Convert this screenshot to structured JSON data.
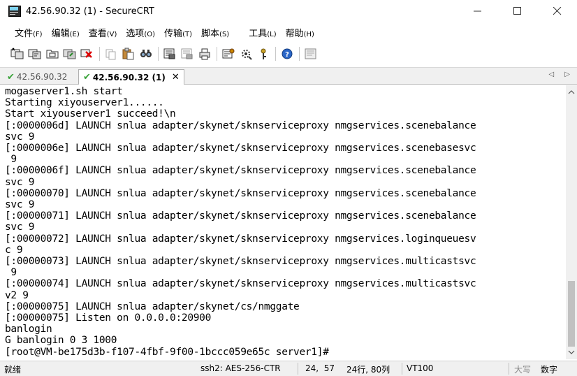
{
  "window": {
    "title": "42.56.90.32 (1) - SecureCRT",
    "icon": "securecrt-app-icon",
    "controls": [
      "minimize-icon",
      "maximize-icon",
      "close-icon"
    ]
  },
  "menu": {
    "file": {
      "label": "文件",
      "accel": "(F)"
    },
    "edit": {
      "label": "编辑",
      "accel": "(E)"
    },
    "view": {
      "label": "查看",
      "accel": "(V)"
    },
    "options": {
      "label": "选项",
      "accel": "(O)"
    },
    "transfer": {
      "label": "传输",
      "accel": "(T)"
    },
    "script": {
      "label": "脚本",
      "accel": "(S)"
    },
    "tools": {
      "label": "工具",
      "accel": "(L)"
    },
    "help": {
      "label": "帮助",
      "accel": "(H)"
    }
  },
  "toolbar": {
    "icons": [
      "connect-icon",
      "quick-connect-icon",
      "connect-in-tab-icon",
      "reconnect-icon",
      "disconnect-icon",
      "copy-icon",
      "paste-icon",
      "find-icon",
      "print-icon",
      "print-selection-icon",
      "printer-icon",
      "session-options-icon",
      "global-options-icon",
      "keymap-icon",
      "help-icon",
      "screenshot-icon"
    ]
  },
  "tabs": [
    {
      "label": "42.56.90.32",
      "active": false
    },
    {
      "label": "42.56.90.32 (1)",
      "active": true,
      "close": "✕"
    }
  ],
  "terminal": {
    "lines": [
      "mogaserver1.sh start",
      "Starting xiyouserver1......",
      "Start xiyouserver1 succeed!\\n",
      "[:0000006d] LAUNCH snlua adapter/skynet/sknserviceproxy nmgservices.scenebalance",
      "svc 9",
      "[:0000006e] LAUNCH snlua adapter/skynet/sknserviceproxy nmgservices.scenebasesvc",
      " 9",
      "[:0000006f] LAUNCH snlua adapter/skynet/sknserviceproxy nmgservices.scenebalance",
      "svc 9",
      "[:00000070] LAUNCH snlua adapter/skynet/sknserviceproxy nmgservices.scenebalance",
      "svc 9",
      "[:00000071] LAUNCH snlua adapter/skynet/sknserviceproxy nmgservices.scenebalance",
      "svc 9",
      "[:00000072] LAUNCH snlua adapter/skynet/sknserviceproxy nmgservices.loginqueuesv",
      "c 9",
      "[:00000073] LAUNCH snlua adapter/skynet/sknserviceproxy nmgservices.multicastsvc",
      " 9",
      "[:00000074] LAUNCH snlua adapter/skynet/sknserviceproxy nmgservices.multicastsvc",
      "v2 9",
      "[:00000075] LAUNCH snlua adapter/skynet/cs/nmggate",
      "[:00000075] Listen on 0.0.0.0:20900",
      "banlogin",
      "G banlogin 0 3 1000",
      "[root@VM-be175d3b-f107-4fbf-9f00-1bccc059e65c server1]#"
    ]
  },
  "statusbar": {
    "ready": "就绪",
    "encryption": "ssh2: AES-256-CTR",
    "cursor": "24,  57",
    "size": "24行, 80列",
    "emulation": "VT100",
    "caps": "大写",
    "num": "数字"
  }
}
